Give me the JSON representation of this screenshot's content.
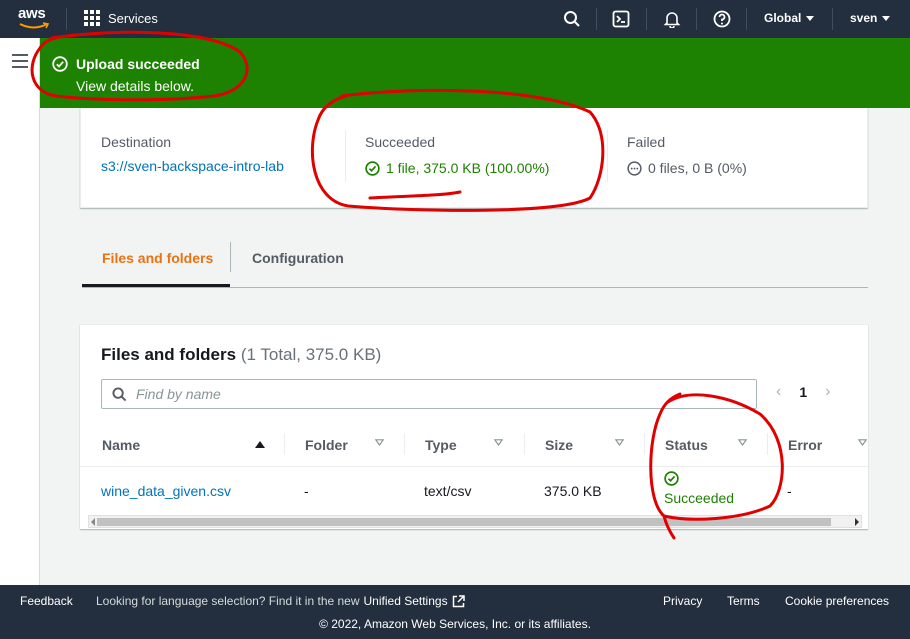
{
  "nav": {
    "logo_text": "aws",
    "services_label": "Services",
    "region_label": "Global",
    "user_label": "sven"
  },
  "flash": {
    "title": "Upload succeeded",
    "subtitle": "View details below."
  },
  "summary": {
    "destination_label": "Destination",
    "destination_value": "s3://sven-backspace-intro-lab",
    "succeeded_label": "Succeeded",
    "succeeded_value": "1 file, 375.0 KB (100.00%)",
    "failed_label": "Failed",
    "failed_value": "0 files, 0 B (0%)"
  },
  "tabs": [
    {
      "label": "Files and folders",
      "active": true
    },
    {
      "label": "Configuration",
      "active": false
    }
  ],
  "table": {
    "title": "Files and folders",
    "count": "(1 Total, 375.0 KB)",
    "search_placeholder": "Find by name",
    "page": "1",
    "columns": [
      "Name",
      "Folder",
      "Type",
      "Size",
      "Status",
      "Error"
    ],
    "rows": [
      {
        "name": "wine_data_given.csv",
        "folder": "-",
        "type": "text/csv",
        "size": "375.0 KB",
        "status": "Succeeded",
        "error": "-"
      }
    ]
  },
  "footer": {
    "feedback": "Feedback",
    "language_prompt": "Looking for language selection? Find it in the new",
    "unified_settings": "Unified Settings",
    "privacy": "Privacy",
    "terms": "Terms",
    "cookie": "Cookie preferences",
    "copyright": "© 2022, Amazon Web Services, Inc. or its affiliates."
  },
  "colors": {
    "nav_bg": "#232f3e",
    "success_green": "#1d8102",
    "link_blue": "#0073bb",
    "tab_active_orange": "#ec7211",
    "annotation_red": "#e00000"
  }
}
